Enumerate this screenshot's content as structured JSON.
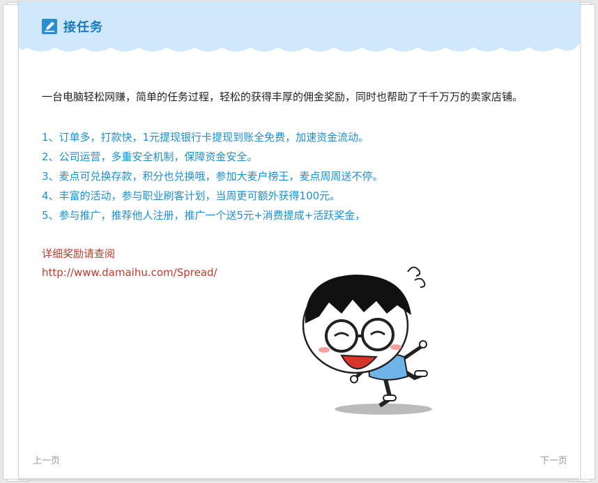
{
  "header": {
    "title": "接任务",
    "icon": "pencil-icon",
    "background_color": "#cfe8fb",
    "title_color": "#1b7bc1"
  },
  "content": {
    "intro": "一台电脑轻松网赚，简单的任务过程，轻松的获得丰厚的佣金奖励，同时也帮助了千千万万的卖家店铺。",
    "benefits": [
      "1、订单多，打款快，1元提现银行卡提现到账全免费，加速资金流动。",
      "2、公司运营，多重安全机制，保障资金安全。",
      "3、麦点可兑换存款，积分也兑换哦，参加大麦户榜王，麦点周周送不停。",
      "4、丰富的活动，参与职业刷客计划，当周更可额外获得100元。",
      "5、参与推广，推荐他人注册，推广一个送5元+消费提成+活跃奖金，"
    ],
    "detail_label": "详细奖励请查阅",
    "detail_link": "http://www.damaihu.com/Spread/"
  },
  "nav": {
    "prev": "上一页",
    "next": "下一页"
  },
  "illustration": "cartoon-boy-mascot"
}
